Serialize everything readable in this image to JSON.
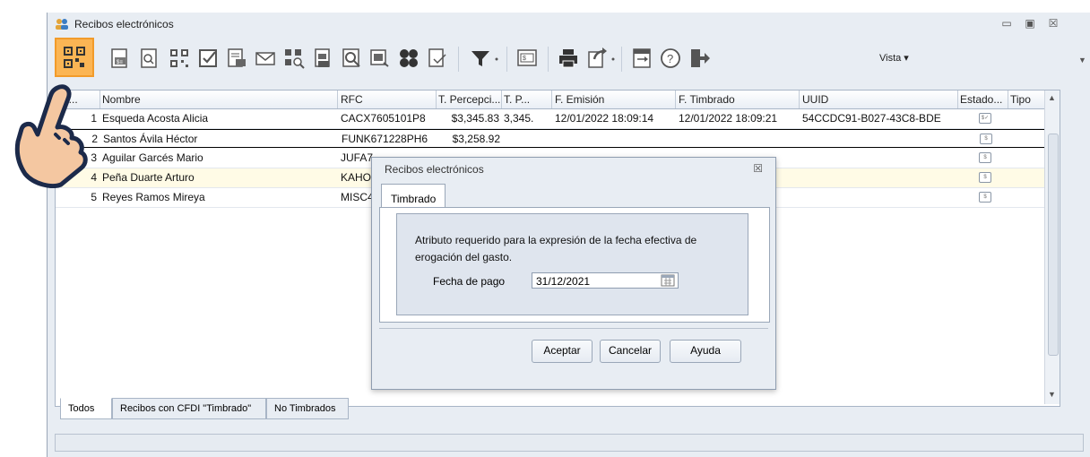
{
  "window": {
    "title": "Recibos electrónicos",
    "controls": [
      "▭",
      "▣",
      "☒"
    ]
  },
  "toolbar": {
    "icons": [
      {
        "name": "qr-timbrar-icon"
      },
      {
        "name": "recibo-icon"
      },
      {
        "name": "preview-icon"
      },
      {
        "name": "qr-code-icon"
      },
      {
        "name": "check-icon"
      },
      {
        "name": "print-recibo-icon"
      },
      {
        "name": "email-icon"
      },
      {
        "name": "qr-search-icon"
      },
      {
        "name": "recibo-print-icon"
      },
      {
        "name": "recibo-search-icon"
      },
      {
        "name": "recibo-export-icon"
      },
      {
        "name": "groups-icon"
      },
      {
        "name": "cancel-doc-icon"
      },
      {
        "name": "filter-icon"
      },
      {
        "name": "recibo-pay-icon"
      },
      {
        "name": "printer-icon"
      },
      {
        "name": "export-arrow-icon"
      },
      {
        "name": "doc-move-icon"
      },
      {
        "name": "help-icon"
      },
      {
        "name": "exit-icon"
      }
    ],
    "vista_label": "Vista ▾"
  },
  "grid": {
    "columns": [
      "N...",
      "Nombre",
      "RFC",
      "T. Percepci...",
      "T. P...",
      "F. Emisión",
      "F. Timbrado",
      "UUID",
      "Estado...",
      "Tipo"
    ],
    "rows": [
      {
        "num": "1",
        "nombre": "Esqueda Acosta Alicia",
        "rfc": "CACX7605101P8",
        "tperc": "$3,345.83",
        "tp": "3,345.",
        "femision": "12/01/2022 18:09:14",
        "ftimbrado": "12/01/2022 18:09:21",
        "uuid": "54CCDC91-B027-43C8-BDE"
      },
      {
        "num": "2",
        "nombre": "Santos Ávila Héctor",
        "rfc": "FUNK671228PH6",
        "tperc": "$3,258.92",
        "tp": "",
        "femision": "",
        "ftimbrado": "",
        "uuid": ""
      },
      {
        "num": "3",
        "nombre": "Aguilar Garcés Mario",
        "rfc": "JUFA7",
        "tperc": "",
        "tp": "",
        "femision": "",
        "ftimbrado": "",
        "uuid": ""
      },
      {
        "num": "4",
        "nombre": "Peña Duarte Arturo",
        "rfc": "KAHO",
        "tperc": "",
        "tp": "",
        "femision": "",
        "ftimbrado": "",
        "uuid": ""
      },
      {
        "num": "5",
        "nombre": "Reyes Ramos Mireya",
        "rfc": "MISC4",
        "tperc": "",
        "tp": "",
        "femision": "",
        "ftimbrado": "",
        "uuid": ""
      }
    ]
  },
  "bottom_tabs": [
    "Todos",
    "Recibos con CFDI \"Timbrado\"",
    "No Timbrados"
  ],
  "dialog": {
    "title": "Recibos electrónicos",
    "close": "☒",
    "tab": "Timbrado",
    "description": "Atributo requerido para la expresión de la fecha efectiva de erogación del gasto.",
    "field_label": "Fecha de pago",
    "field_value": "31/12/2021",
    "buttons": {
      "accept": "Aceptar",
      "cancel": "Cancelar",
      "help": "Ayuda"
    }
  }
}
